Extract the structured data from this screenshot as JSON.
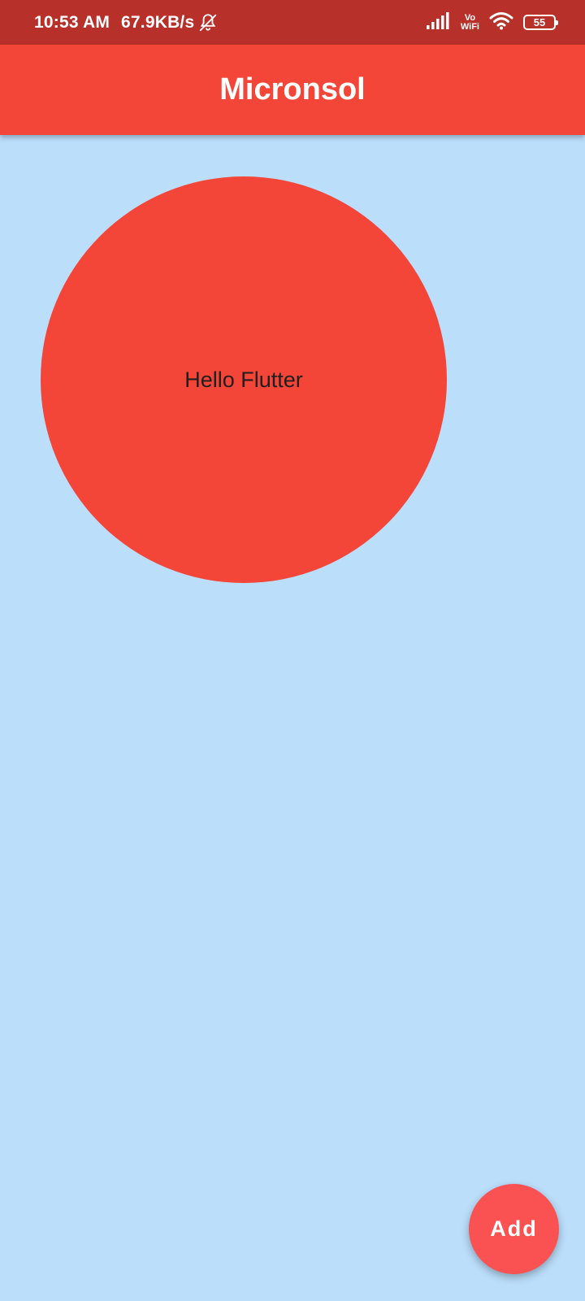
{
  "status_bar": {
    "time": "10:53 AM",
    "network_speed": "67.9KB/s",
    "vowifi_top": "Vo",
    "vowifi_bottom": "WiFi",
    "battery": "55",
    "icons": [
      "bell-off-icon",
      "signal-icon",
      "vowifi-icon",
      "wifi-icon",
      "battery-icon"
    ]
  },
  "app_bar": {
    "title": "Micronsol"
  },
  "main": {
    "circle_text": "Hello Flutter"
  },
  "fab": {
    "label": "Add"
  },
  "colors": {
    "status_bar": "#b7312a",
    "app_bar": "#f44539",
    "background": "#bbdefb",
    "circle": "#f44539",
    "fab": "#fa5252"
  }
}
